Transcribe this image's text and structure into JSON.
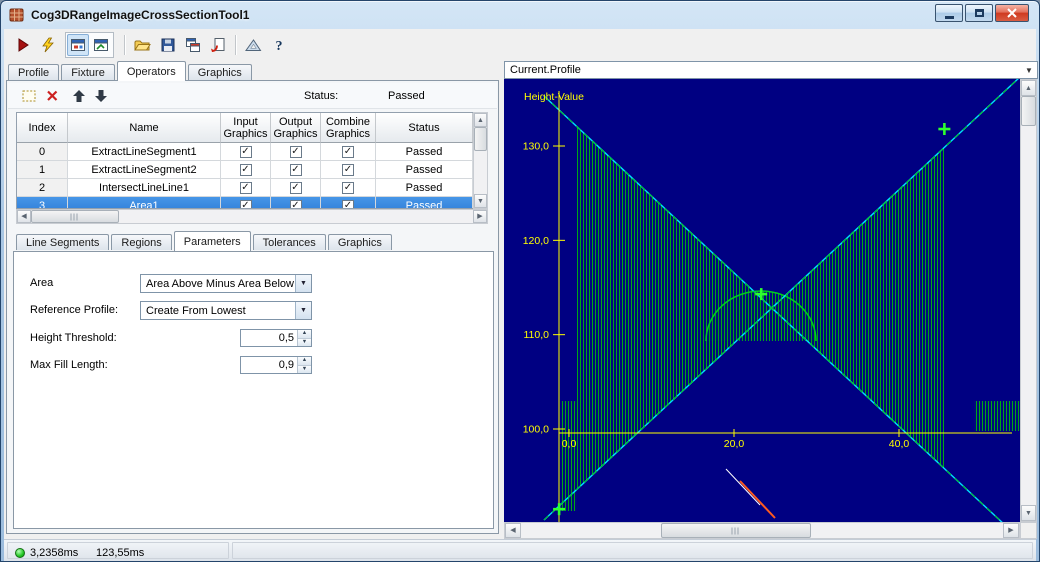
{
  "window": {
    "title": "Cog3DRangeImageCrossSectionTool1"
  },
  "titlebar_buttons": [
    "minimize",
    "maximize",
    "close"
  ],
  "icons": {
    "check": "✓",
    "toolbar": [
      "run-icon",
      "trigger-icon",
      "image-display-toggle-icon",
      "graphics-display-toggle-icon",
      "open-file-icon",
      "save-file-icon",
      "windows-icon",
      "import-icon",
      "measure-icon",
      "help-icon"
    ],
    "operator_toolbar": [
      "new-operator-icon",
      "delete-operator-icon",
      "move-up-icon",
      "move-down-icon"
    ]
  },
  "tabs": {
    "items": [
      "Profile",
      "Fixture",
      "Operators",
      "Graphics"
    ],
    "active_index": 2
  },
  "operators": {
    "status_label": "Status:",
    "status_value": "Passed",
    "grid": {
      "headers": [
        "Index",
        "Name",
        "Input Graphics",
        "Output Graphics",
        "Combine Graphics",
        "Status"
      ],
      "rows": [
        {
          "index": "0",
          "name": "ExtractLineSegment1",
          "input_graphics": true,
          "output_graphics": true,
          "combine_graphics": true,
          "status": "Passed",
          "selected": false
        },
        {
          "index": "1",
          "name": "ExtractLineSegment2",
          "input_graphics": true,
          "output_graphics": true,
          "combine_graphics": true,
          "status": "Passed",
          "selected": false
        },
        {
          "index": "2",
          "name": "IntersectLineLine1",
          "input_graphics": true,
          "output_graphics": true,
          "combine_graphics": true,
          "status": "Passed",
          "selected": false
        },
        {
          "index": "3",
          "name": "Area1",
          "input_graphics": true,
          "output_graphics": true,
          "combine_graphics": true,
          "status": "Passed",
          "selected": true
        }
      ]
    }
  },
  "subtabs": {
    "items": [
      "Line Segments",
      "Regions",
      "Parameters",
      "Tolerances",
      "Graphics"
    ],
    "active_index": 2
  },
  "parameters": {
    "area": {
      "label": "Area",
      "value": "Area Above Minus Area Below"
    },
    "reference_profile": {
      "label": "Reference Profile:",
      "value": "Create From Lowest"
    },
    "height_threshold": {
      "label": "Height Threshold:",
      "value": "0,5"
    },
    "max_fill_length": {
      "label": "Max Fill Length:",
      "value": "0,9"
    }
  },
  "display": {
    "selector_value": "Current.Profile",
    "chart_data": {
      "type": "area",
      "title": "Height-Value",
      "background": "#000082",
      "axis_color": "#ffff00",
      "y_axis": {
        "range": [
          90.5,
          137.5
        ],
        "ticks": [
          {
            "value": 130,
            "label": "130,0"
          },
          {
            "value": 120,
            "label": "120,0"
          },
          {
            "value": 110,
            "label": "110,0"
          },
          {
            "value": 100,
            "label": "100,0"
          }
        ]
      },
      "x_axis": {
        "range": [
          -1.5,
          54
        ],
        "ticks": [
          {
            "value": 0,
            "label": "0,0"
          },
          {
            "value": 20,
            "label": "20,0"
          },
          {
            "value": 40,
            "label": "40,0"
          }
        ]
      },
      "series": [
        {
          "name": "profile",
          "color": "#00c41e",
          "style": "dashed-line"
        },
        {
          "name": "reference-profile-cross-lines",
          "color": "#00e0ff",
          "style": "solid-line"
        },
        {
          "name": "computed-area-region",
          "color": "#00a616",
          "style": "vertical-hatch-fill"
        }
      ],
      "markers": [
        {
          "type": "cross",
          "color": "#2eff2e",
          "x": -1.2,
          "y": 91.5
        },
        {
          "type": "cross",
          "color": "#2eff2e",
          "x": 23.3,
          "y": 114.3
        },
        {
          "type": "cross",
          "color": "#2eff2e",
          "x": 45.5,
          "y": 131.8
        }
      ]
    }
  },
  "statusbar": {
    "execution_time": "3,2358ms",
    "total_time": "123,55ms"
  }
}
